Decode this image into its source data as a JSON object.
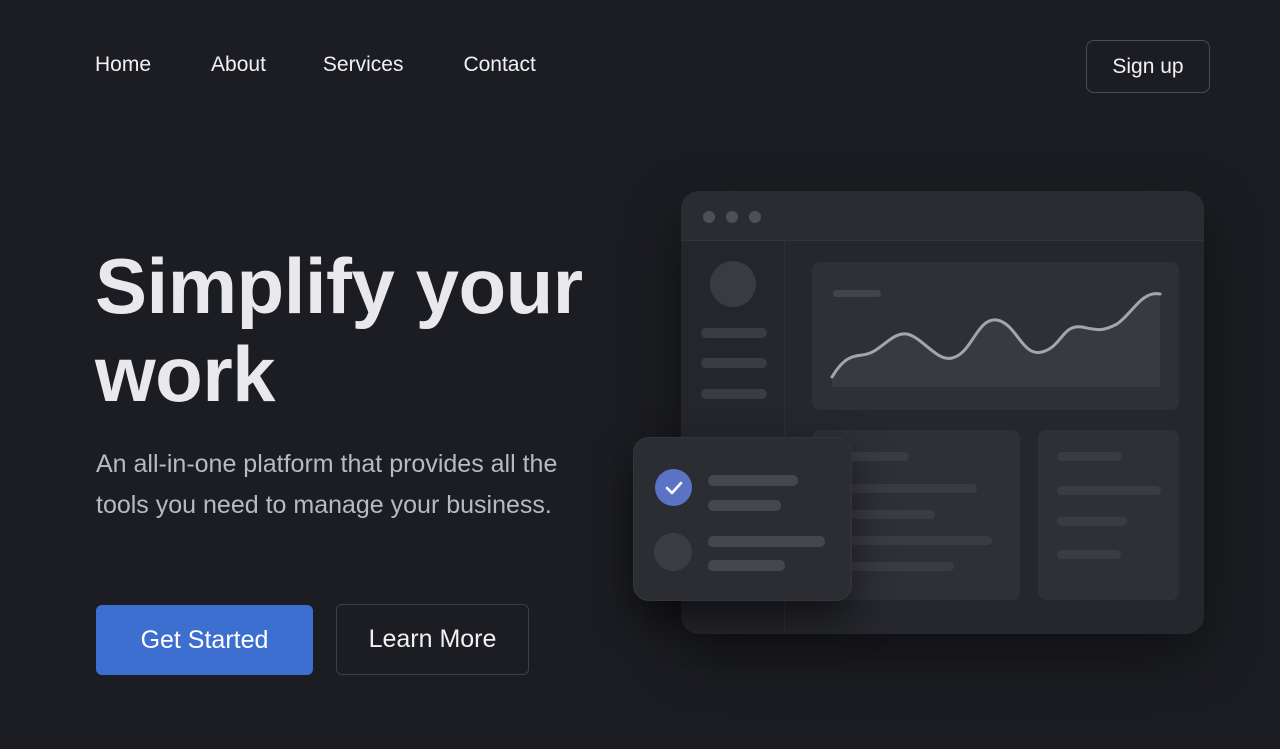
{
  "nav": {
    "links": [
      {
        "label": "Home"
      },
      {
        "label": "About"
      },
      {
        "label": "Services"
      },
      {
        "label": "Contact"
      }
    ],
    "signup_label": "Sign up"
  },
  "hero": {
    "title": "Simplify your work",
    "subtitle": "An all-in-one platform that provides all the tools you need to manage your business.",
    "primary_cta": "Get Started",
    "secondary_cta": "Learn More"
  },
  "colors": {
    "background": "#1c1d22",
    "accent": "#3d6fd1",
    "check": "#5b73c4"
  },
  "icons": {
    "check": "check-icon",
    "window_dots": "window-control-dot-icon"
  }
}
